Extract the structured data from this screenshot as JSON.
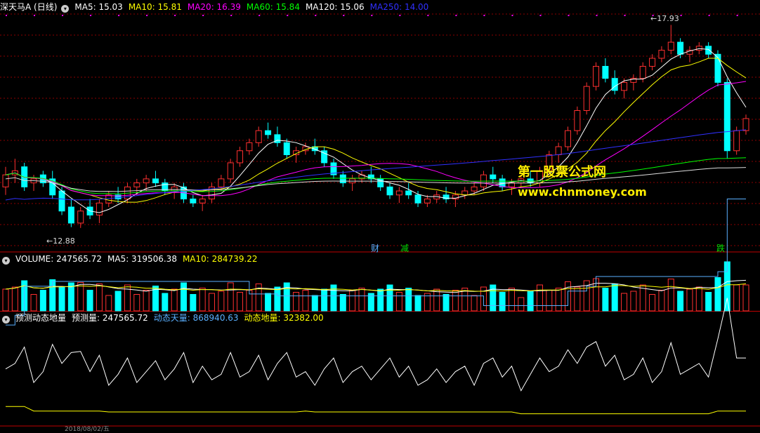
{
  "panel_main": {
    "title": "深天马A (日线)",
    "indicators": [
      {
        "label": "MA5: 15.03",
        "color": "#ffffff"
      },
      {
        "label": "MA10: 15.81",
        "color": "#ffff00"
      },
      {
        "label": "MA20: 16.39",
        "color": "#ff00ff"
      },
      {
        "label": "MA60: 15.84",
        "color": "#00ff00"
      },
      {
        "label": "MA120: 15.06",
        "color": "#ffffff"
      },
      {
        "label": "MA250: 14.00",
        "color": "#3030ff"
      }
    ],
    "high_label": "17.93",
    "low_label": "12.88",
    "markers": [
      {
        "text": "财",
        "x": 528,
        "color": "#5ab0ff"
      },
      {
        "text": "减",
        "x": 570,
        "color": "#00dd00"
      },
      {
        "text": "跌",
        "x": 1020,
        "color": "#00dd00"
      }
    ]
  },
  "panel_volume": {
    "indicators": [
      {
        "label": "VOLUME: 247565.72",
        "color": "#ffffff"
      },
      {
        "label": "MA5: 319506.38",
        "color": "#ffffff"
      },
      {
        "label": "MA10: 284739.22",
        "color": "#ffff00"
      }
    ]
  },
  "panel_indicator": {
    "indicators": [
      {
        "label": "预测动态地量",
        "color": "#ffffff"
      },
      {
        "label": "预测量: 247565.72",
        "color": "#ffffff"
      },
      {
        "label": "动态天量: 868940.63",
        "color": "#5ab0ff"
      },
      {
        "label": "动态地量: 32382.00",
        "color": "#ffff00"
      }
    ]
  },
  "date_axis_label": "2018/08/02/五",
  "watermark": {
    "line1": "第一股票公式网",
    "line2": "www.chnmoney.com"
  },
  "colors": {
    "up": "#ff3030",
    "down": "#00ffff",
    "grid": "#8b0000",
    "separator": "#c00000"
  },
  "chart_data": {
    "type": "candlestick",
    "y_range": [
      12.3,
      18.2
    ],
    "candles": [
      [
        13.9,
        14.4,
        13.7,
        14.2
      ],
      [
        14.2,
        14.6,
        14.0,
        14.3
      ],
      [
        14.4,
        14.5,
        13.8,
        13.9
      ],
      [
        14.0,
        14.2,
        13.8,
        14.1
      ],
      [
        14.2,
        14.3,
        13.9,
        14.0
      ],
      [
        14.1,
        14.3,
        13.6,
        13.7
      ],
      [
        13.8,
        13.9,
        13.2,
        13.3
      ],
      [
        13.4,
        13.6,
        12.9,
        13.0
      ],
      [
        13.0,
        13.4,
        12.88,
        13.3
      ],
      [
        13.4,
        13.6,
        13.1,
        13.2
      ],
      [
        13.2,
        13.6,
        13.0,
        13.5
      ],
      [
        13.5,
        13.8,
        13.4,
        13.7
      ],
      [
        13.7,
        13.9,
        13.5,
        13.6
      ],
      [
        13.6,
        14.0,
        13.5,
        13.9
      ],
      [
        13.9,
        14.1,
        13.7,
        14.0
      ],
      [
        14.0,
        14.2,
        13.8,
        14.1
      ],
      [
        14.1,
        14.3,
        13.9,
        14.0
      ],
      [
        14.0,
        14.1,
        13.7,
        13.8
      ],
      [
        13.8,
        14.0,
        13.6,
        13.9
      ],
      [
        13.9,
        14.0,
        13.5,
        13.6
      ],
      [
        13.6,
        13.7,
        13.4,
        13.5
      ],
      [
        13.5,
        13.7,
        13.3,
        13.6
      ],
      [
        13.6,
        14.0,
        13.5,
        13.9
      ],
      [
        13.9,
        14.2,
        13.8,
        14.1
      ],
      [
        14.1,
        14.6,
        14.0,
        14.5
      ],
      [
        14.5,
        14.9,
        14.4,
        14.8
      ],
      [
        14.8,
        15.1,
        14.7,
        15.0
      ],
      [
        15.0,
        15.4,
        14.9,
        15.3
      ],
      [
        15.3,
        15.5,
        15.1,
        15.2
      ],
      [
        15.2,
        15.4,
        14.9,
        15.0
      ],
      [
        15.0,
        15.1,
        14.6,
        14.7
      ],
      [
        14.7,
        14.9,
        14.5,
        14.8
      ],
      [
        14.8,
        15.0,
        14.7,
        14.9
      ],
      [
        14.9,
        15.1,
        14.7,
        14.8
      ],
      [
        14.8,
        14.9,
        14.4,
        14.5
      ],
      [
        14.5,
        14.6,
        14.1,
        14.2
      ],
      [
        14.2,
        14.3,
        13.9,
        14.0
      ],
      [
        14.0,
        14.2,
        13.8,
        14.1
      ],
      [
        14.1,
        14.3,
        14.0,
        14.2
      ],
      [
        14.2,
        14.4,
        14.0,
        14.1
      ],
      [
        14.1,
        14.2,
        13.8,
        13.9
      ],
      [
        13.9,
        14.0,
        13.6,
        13.7
      ],
      [
        13.7,
        13.9,
        13.5,
        13.8
      ],
      [
        13.8,
        14.0,
        13.6,
        13.7
      ],
      [
        13.7,
        13.8,
        13.4,
        13.5
      ],
      [
        13.5,
        13.7,
        13.4,
        13.6
      ],
      [
        13.6,
        13.8,
        13.5,
        13.7
      ],
      [
        13.7,
        13.9,
        13.5,
        13.6
      ],
      [
        13.6,
        13.8,
        13.4,
        13.7
      ],
      [
        13.7,
        13.9,
        13.6,
        13.8
      ],
      [
        13.8,
        14.0,
        13.7,
        13.9
      ],
      [
        13.9,
        14.3,
        13.8,
        14.2
      ],
      [
        14.2,
        14.4,
        14.0,
        14.1
      ],
      [
        14.1,
        14.2,
        13.8,
        13.9
      ],
      [
        13.9,
        14.1,
        13.7,
        14.0
      ],
      [
        14.0,
        14.2,
        13.9,
        14.1
      ],
      [
        14.1,
        14.3,
        13.9,
        14.0
      ],
      [
        14.0,
        14.4,
        13.9,
        14.3
      ],
      [
        14.3,
        14.8,
        14.2,
        14.7
      ],
      [
        14.7,
        15.0,
        14.5,
        14.9
      ],
      [
        14.9,
        15.4,
        14.8,
        15.3
      ],
      [
        15.3,
        15.9,
        15.2,
        15.8
      ],
      [
        15.8,
        16.5,
        15.7,
        16.4
      ],
      [
        16.4,
        17.0,
        16.3,
        16.9
      ],
      [
        16.9,
        17.1,
        16.5,
        16.6
      ],
      [
        16.6,
        16.8,
        16.2,
        16.3
      ],
      [
        16.3,
        16.6,
        16.1,
        16.5
      ],
      [
        16.5,
        16.7,
        16.3,
        16.6
      ],
      [
        16.6,
        17.0,
        16.5,
        16.9
      ],
      [
        16.9,
        17.2,
        16.8,
        17.1
      ],
      [
        17.1,
        17.4,
        17.0,
        17.3
      ],
      [
        17.3,
        17.93,
        17.2,
        17.5
      ],
      [
        17.5,
        17.6,
        17.1,
        17.2
      ],
      [
        17.2,
        17.4,
        17.0,
        17.3
      ],
      [
        17.3,
        17.5,
        17.2,
        17.4
      ],
      [
        17.4,
        17.5,
        17.1,
        17.2
      ],
      [
        17.2,
        17.3,
        16.4,
        16.5
      ],
      [
        16.5,
        16.6,
        14.6,
        14.8
      ],
      [
        14.8,
        15.4,
        14.7,
        15.3
      ],
      [
        15.3,
        15.7,
        15.2,
        15.6
      ]
    ],
    "ma_colors": [
      "#ffffff",
      "#ffff00",
      "#ff00ff",
      "#00ff00",
      "#dddddd",
      "#3030ff"
    ],
    "volume": {
      "y_range": [
        0,
        1300000
      ]
    },
    "indicator": {
      "y_range": [
        0,
        1000000
      ]
    }
  }
}
